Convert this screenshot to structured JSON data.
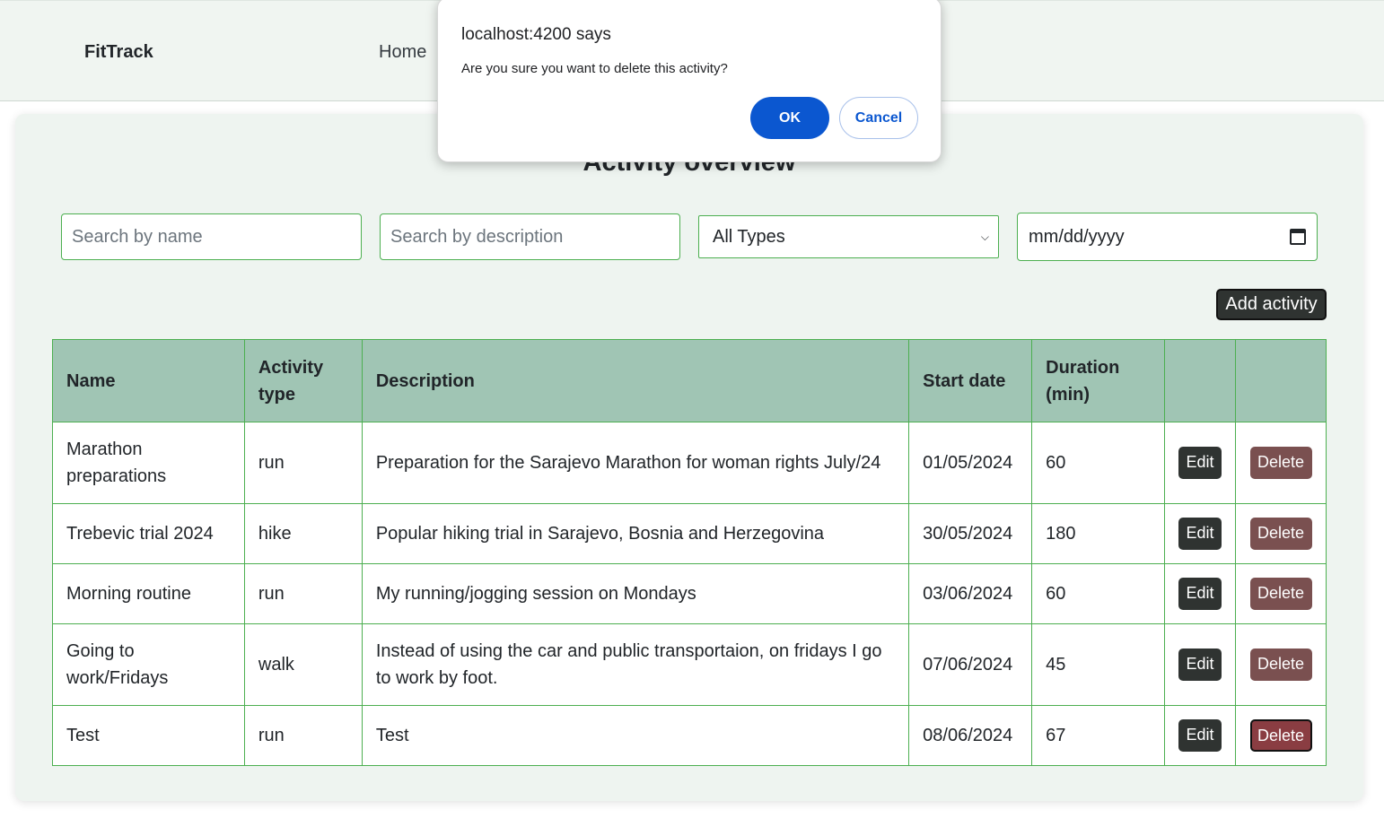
{
  "app": {
    "brand": "FitTrack"
  },
  "nav": {
    "home": "Home"
  },
  "page": {
    "title": "Activity overview"
  },
  "filters": {
    "name_placeholder": "Search by name",
    "description_placeholder": "Search by description",
    "type_selected": "All Types",
    "date_placeholder": "mm/dd/yyyy"
  },
  "actions": {
    "add_activity": "Add activity"
  },
  "table": {
    "headers": [
      "Name",
      "Activity type",
      "Description",
      "Start date",
      "Duration (min)",
      "",
      ""
    ],
    "header_lines": {
      "activity_type": [
        "Activity",
        "type"
      ],
      "duration": [
        "Duration",
        "(min)"
      ]
    },
    "rows": [
      {
        "name": "Marathon preparations",
        "type": "run",
        "description": "Preparation for the Sarajevo Marathon for woman rights July/24",
        "start": "01/05/2024",
        "duration": "60"
      },
      {
        "name": "Trebevic trial 2024",
        "type": "hike",
        "description": "Popular hiking trial in Sarajevo, Bosnia and Herzegovina",
        "start": "30/05/2024",
        "duration": "180"
      },
      {
        "name": "Morning routine",
        "type": "run",
        "description": "My running/jogging session on Mondays",
        "start": "03/06/2024",
        "duration": "60"
      },
      {
        "name": "Going to work/Fridays",
        "type": "walk",
        "description": "Instead of using the car and public transportaion, on fridays I go to work by foot.",
        "start": "07/06/2024",
        "duration": "45"
      },
      {
        "name": "Test",
        "type": "run",
        "description": "Test",
        "start": "08/06/2024",
        "duration": "67"
      }
    ],
    "edit_label": "Edit",
    "delete_label": "Delete"
  },
  "dialog": {
    "title": "localhost:4200 says",
    "message": "Are you sure you want to delete this activity?",
    "ok": "OK",
    "cancel": "Cancel"
  },
  "colors": {
    "accent_border": "#4caf50",
    "header_bg": "#a0c5b4",
    "dialog_ok": "#0b57d0",
    "delete_btn": "#7a5050"
  }
}
